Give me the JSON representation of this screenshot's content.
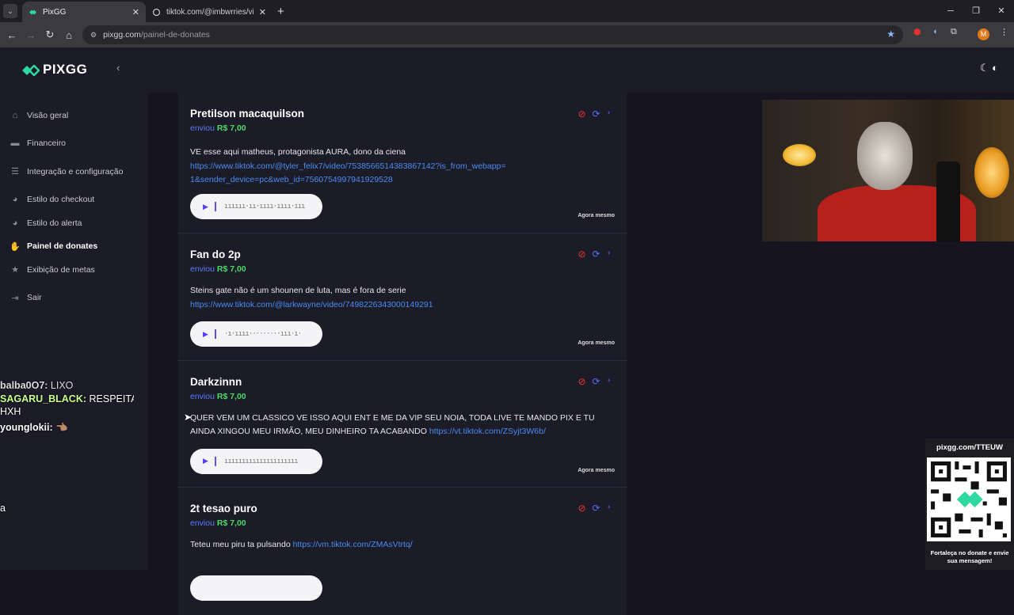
{
  "browser": {
    "tabs": [
      {
        "title": "PixGG",
        "active": true
      },
      {
        "title": "tiktok.com/@imbwrries/video/",
        "active": false
      }
    ],
    "url_domain": "pixgg.com",
    "url_path": "/painel-de-donates",
    "profile_initial": "M"
  },
  "sidebar": {
    "logo_text": "PIXGG",
    "items": [
      {
        "label": "Visão geral",
        "icon": "home-icon"
      },
      {
        "label": "Financeiro",
        "icon": "card-icon"
      },
      {
        "label": "Integração e configuração",
        "icon": "settings-icon"
      },
      {
        "label": "Estilo do checkout",
        "icon": "palette-icon"
      },
      {
        "label": "Estilo do alerta",
        "icon": "palette-icon"
      },
      {
        "label": "Painel de donates",
        "icon": "donate-hand-icon",
        "active": true
      },
      {
        "label": "Exibição de metas",
        "icon": "star-icon"
      },
      {
        "label": "Sair",
        "icon": "logout-icon"
      }
    ]
  },
  "chat_overlay": [
    {
      "user": "balba0O7:",
      "text": "LIXO"
    },
    {
      "user": "SAGARU_BLACK:",
      "text": "RESPEITA HXH"
    },
    {
      "user": "younglokii:",
      "text": "👈🏽"
    },
    {
      "user": "",
      "text": "a"
    }
  ],
  "donations": [
    {
      "name": "Pretilson macaquilson",
      "sent_label": "enviou",
      "amount": "R$ 7,00",
      "message": "VE esse aqui matheus, protagonista AURA, dono da ciena",
      "link": "https://www.tiktok.com/@tyler_felix7/video/7538566514383867142?is_from_webapp=1&sender_device=pc&web_id=7560754997941929528",
      "time": "Agora mesmo"
    },
    {
      "name": "Fan do 2p",
      "sent_label": "enviou",
      "amount": "R$ 7,00",
      "message": "Steins gate não é um shounen de luta, mas é fora de serie",
      "link": "https://www.tiktok.com/@larkwayne/video/7498226343000149291",
      "time": "Agora mesmo"
    },
    {
      "name": "Darkzinnn",
      "sent_label": "enviou",
      "amount": "R$ 7,00",
      "message": "QUER VEM UM CLASSICO VE ISSO AQUI ENT E ME DA VIP SEU NOIA, TODA LIVE TE MANDO PIX E TU AINDA XINGOU MEU IRMÃO, MEU DINHEIRO TA ACABANDO",
      "link": "https://vt.tiktok.com/ZSyjt3W6b/",
      "time": "Agora mesmo"
    },
    {
      "name": "2t tesao puro",
      "sent_label": "enviou",
      "amount": "R$ 7,00",
      "message": "Teteu meu piru ta pulsando",
      "link": "https://vm.tiktok.com/ZMAsVtrtq/",
      "time": ""
    }
  ],
  "qr_overlay": {
    "url": "pixgg.com/TTEUW",
    "caption": "Fortaleça no donate e envie sua mensagem!"
  },
  "colors": {
    "accent_blue": "#5b7cf6",
    "amount_green": "#4cd964",
    "link_blue": "#4a8cf0",
    "block_red": "#e33333",
    "logo_teal": "#2ed8a0"
  }
}
